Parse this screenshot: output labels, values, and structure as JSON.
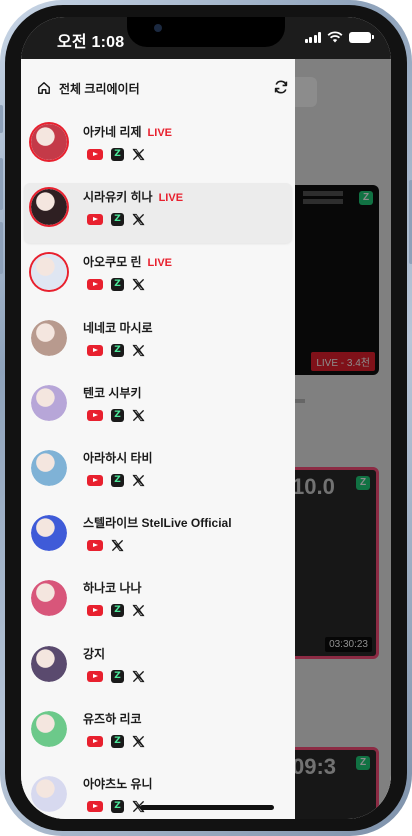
{
  "status_bar": {
    "time": "오전 1:08"
  },
  "drawer": {
    "title": "전체 크리에이터",
    "creators": [
      {
        "name": "아카네 리제",
        "live": true,
        "live_label": "LIVE",
        "platforms": [
          "youtube",
          "chzzk",
          "x"
        ],
        "avatar_color": "#c43a48",
        "highlight": false
      },
      {
        "name": "시라유키 히나",
        "live": true,
        "live_label": "LIVE",
        "platforms": [
          "youtube",
          "chzzk",
          "x"
        ],
        "avatar_color": "#2e1f22",
        "highlight": true
      },
      {
        "name": "아오쿠모 린",
        "live": true,
        "live_label": "LIVE",
        "platforms": [
          "youtube",
          "chzzk",
          "x"
        ],
        "avatar_color": "#dfe6f2",
        "highlight": false
      },
      {
        "name": "네네코 마시로",
        "live": false,
        "live_label": "",
        "platforms": [
          "youtube",
          "chzzk",
          "x"
        ],
        "avatar_color": "#b89a8e",
        "highlight": false
      },
      {
        "name": "텐코 시부키",
        "live": false,
        "live_label": "",
        "platforms": [
          "youtube",
          "chzzk",
          "x"
        ],
        "avatar_color": "#b7a6d8",
        "highlight": false
      },
      {
        "name": "아라하시 타비",
        "live": false,
        "live_label": "",
        "platforms": [
          "youtube",
          "chzzk",
          "x"
        ],
        "avatar_color": "#7fb2d6",
        "highlight": false
      },
      {
        "name": "스텔라이브 StelLive Official",
        "live": false,
        "live_label": "",
        "platforms": [
          "youtube",
          "x"
        ],
        "avatar_color": "#3f5bd8",
        "highlight": false
      },
      {
        "name": "하나코 나나",
        "live": false,
        "live_label": "",
        "platforms": [
          "youtube",
          "chzzk",
          "x"
        ],
        "avatar_color": "#d8567a",
        "highlight": false
      },
      {
        "name": "강지",
        "live": false,
        "live_label": "",
        "platforms": [
          "youtube",
          "chzzk",
          "x"
        ],
        "avatar_color": "#5a4a6e",
        "highlight": false
      },
      {
        "name": "유즈하 리코",
        "live": false,
        "live_label": "",
        "platforms": [
          "youtube",
          "chzzk",
          "x"
        ],
        "avatar_color": "#6cc98a",
        "highlight": false
      },
      {
        "name": "아야츠노 유니",
        "live": false,
        "live_label": "",
        "platforms": [
          "youtube",
          "chzzk",
          "x"
        ],
        "avatar_color": "#d7d9ef",
        "highlight": false
      }
    ]
  },
  "background": {
    "card1_badge": "LIVE - 3.4천",
    "card2_big": "10.0",
    "card2_time": "03:30:23",
    "card3_big": "09:3"
  },
  "colors": {
    "live": "#e8202e",
    "youtube": "#e8202e",
    "chzzk": "#1a1a1a"
  }
}
